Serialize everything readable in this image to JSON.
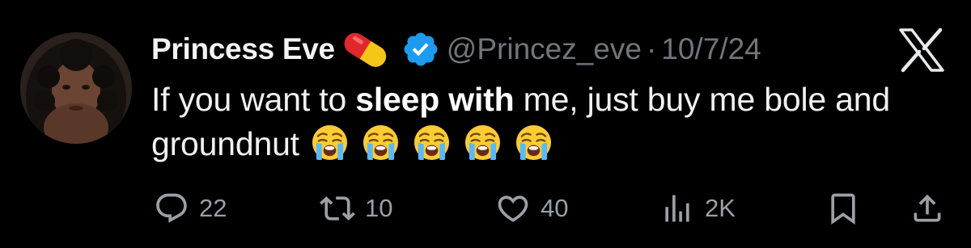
{
  "author": {
    "name": "Princess Eve",
    "handle": "@Princez_eve",
    "separator": "·",
    "date": "10/7/24",
    "name_emoji": "pill-icon",
    "verified": "verified-badge-icon"
  },
  "tweet": {
    "text_before": "If you want to ",
    "text_bold": "sleep with",
    "text_after": " me, just buy me bole and groundnut",
    "emojis": [
      "loudly-crying-face",
      "loudly-crying-face",
      "loudly-crying-face",
      "loudly-crying-face",
      "loudly-crying-face"
    ]
  },
  "actions": {
    "replies": "22",
    "reposts": "10",
    "likes": "40",
    "views": "2K"
  },
  "colors": {
    "background": "#000000",
    "text": "#e7e9ea",
    "muted": "#71767b",
    "verified": "#1d9bf0"
  }
}
